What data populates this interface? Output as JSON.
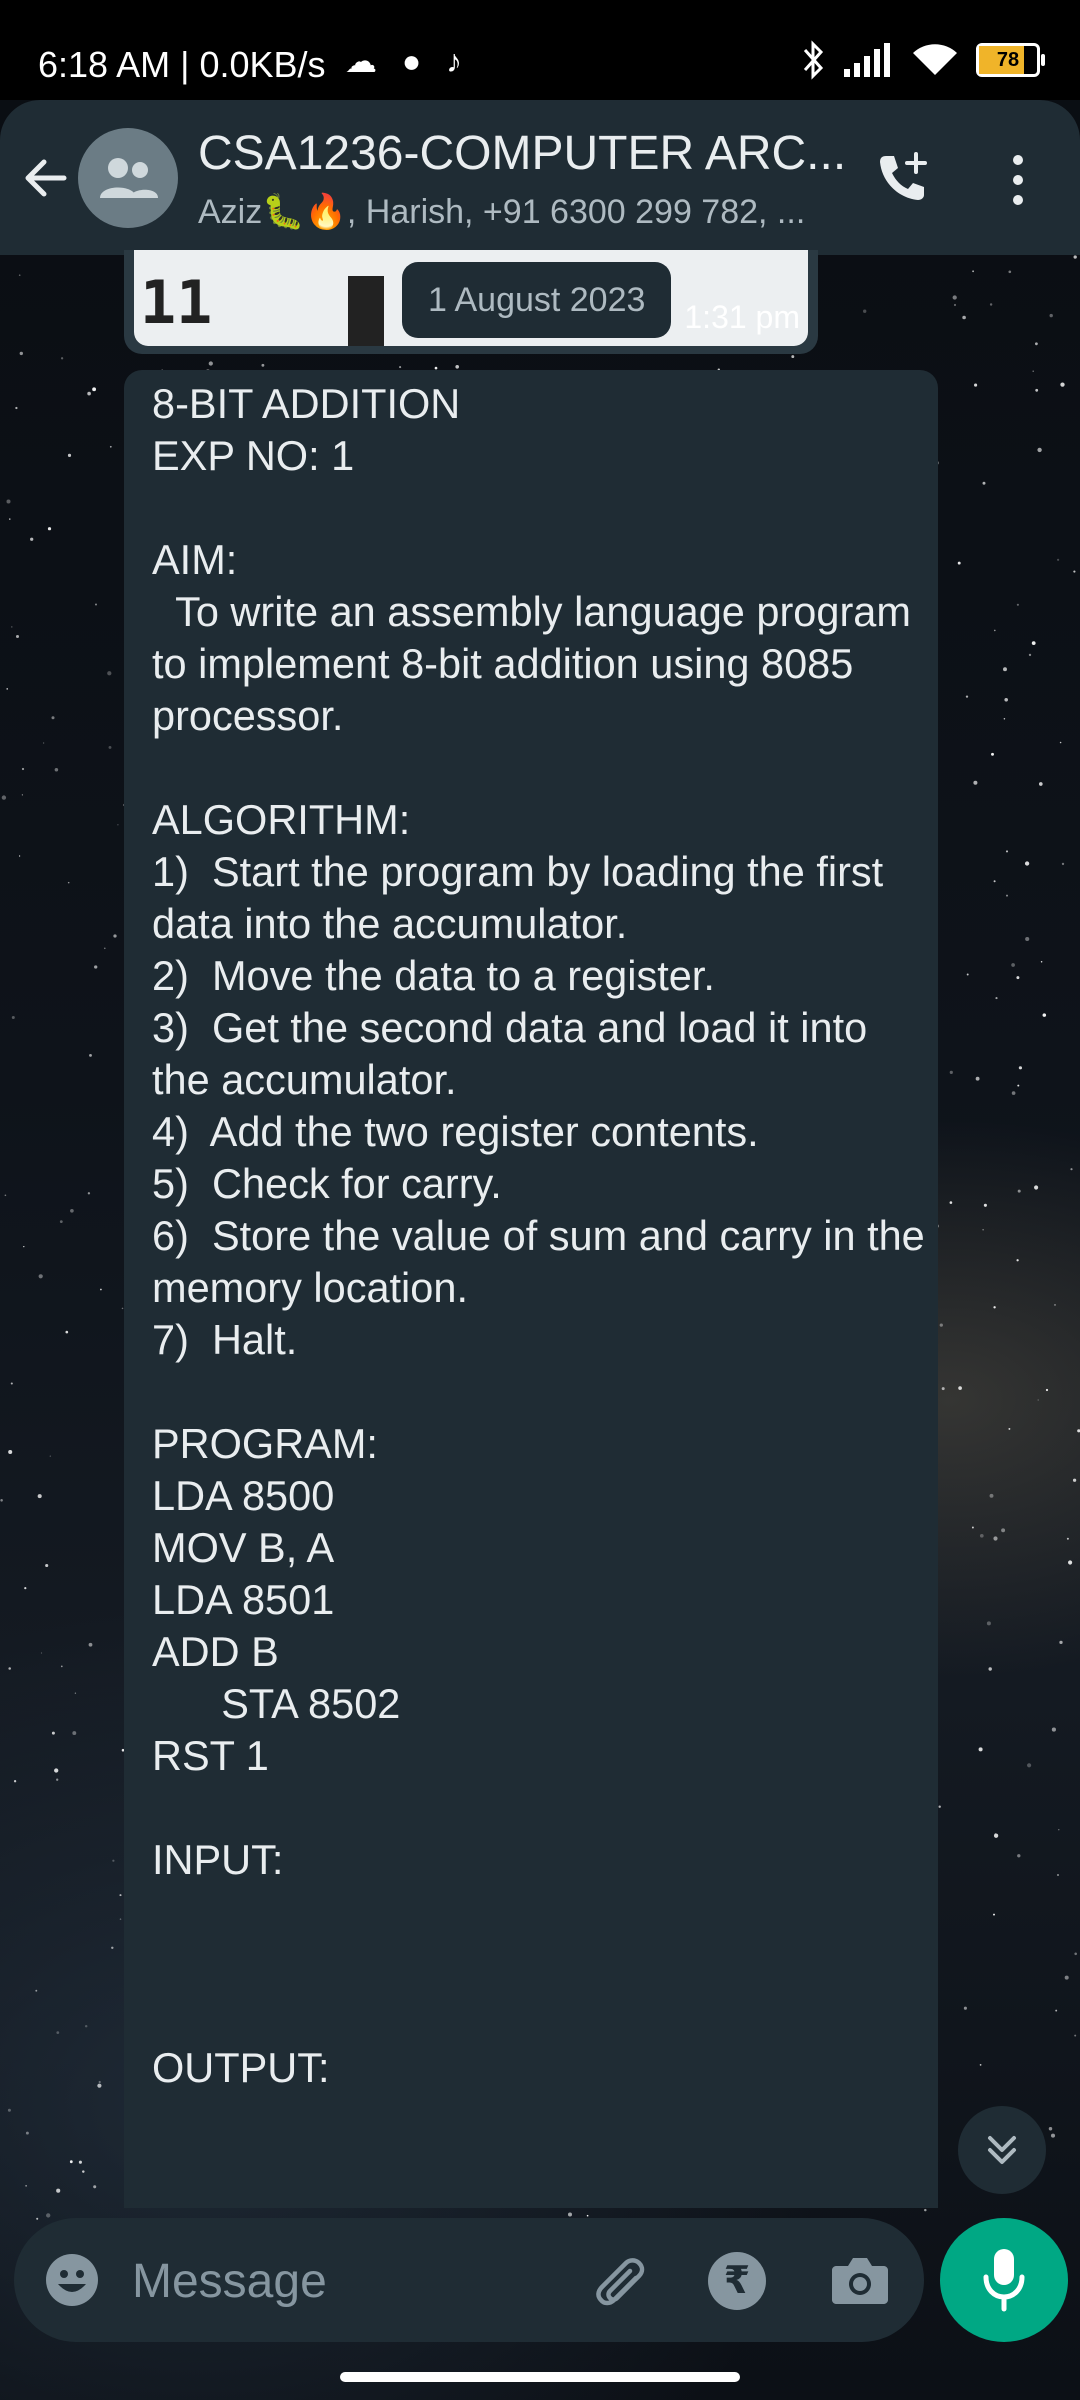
{
  "status_bar": {
    "time": "6:18 AM | 0.0KB/s",
    "battery": "78"
  },
  "header": {
    "title": "CSA1236-COMPUTER ARC...",
    "subtitle": "Aziz🐛🔥, Harish, +91 6300 299 782, ..."
  },
  "image_message": {
    "preview_text": "11",
    "time": "1:31 pm"
  },
  "date_chip": "1 August 2023",
  "message": {
    "text": "8-BIT ADDITION\nEXP NO: 1\n\nAIM:\n  To write an assembly language program to implement 8-bit addition using 8085 processor.\n\nALGORITHM:\n1)  Start the program by loading the first data into the accumulator.\n2)  Move the data to a register.\n3)  Get the second data and load it into the accumulator.\n4)  Add the two register contents.\n5)  Check for carry.\n6)  Store the value of sum and carry in the memory location.\n7)  Halt.\n\nPROGRAM:\nLDA 8500\nMOV B, A\nLDA 8501\nADD B\n      STA 8502\nRST 1\n\nINPUT:\n\n\n\nOUTPUT:"
  },
  "input": {
    "placeholder": "Message",
    "rupee_symbol": "₹"
  },
  "colors": {
    "header_bg": "#1f2c34",
    "bubble_bg": "#1f2c34",
    "accent": "#00a884",
    "muted_text": "#8696a0"
  },
  "icons": {
    "back": "arrow-left-icon",
    "avatar": "group-avatar-icon",
    "call_add": "phone-plus-icon",
    "menu": "more-vert-icon",
    "scroll_down": "double-chevron-down-icon",
    "emoji": "emoji-icon",
    "attach": "paperclip-icon",
    "payment": "rupee-icon",
    "camera": "camera-icon",
    "mic": "mic-icon"
  }
}
